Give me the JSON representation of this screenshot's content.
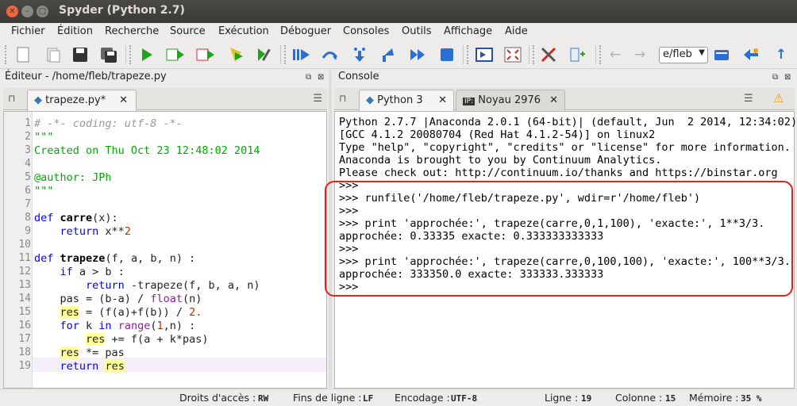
{
  "window": {
    "title": "Spyder (Python 2.7)"
  },
  "menu": [
    "Fichier",
    "Édition",
    "Recherche",
    "Source",
    "Exécution",
    "Déboguer",
    "Consoles",
    "Outils",
    "Affichage",
    "Aide"
  ],
  "toolbar": {
    "working_dir": "e/fleb"
  },
  "editor_pane": {
    "title": "Éditeur - /home/fleb/trapeze.py",
    "tab_label": "trapeze.py*",
    "current_line": 19
  },
  "console_pane": {
    "title": "Console",
    "tabs": [
      {
        "label": "Python 3"
      },
      {
        "label": "Noyau 2976"
      }
    ],
    "lines": [
      "Python 2.7.7 |Anaconda 2.0.1 (64-bit)| (default, Jun  2 2014, 12:34:02)",
      "[GCC 4.1.2 20080704 (Red Hat 4.1.2-54)] on linux2",
      "Type \"help\", \"copyright\", \"credits\" or \"license\" for more information.",
      "Anaconda is brought to you by Continuum Analytics.",
      "Please check out: http://continuum.io/thanks and https://binstar.org",
      ">>> ",
      ">>> runfile('/home/fleb/trapeze.py', wdir=r'/home/fleb')",
      ">>> ",
      ">>> print 'approchée:', trapeze(carre,0,1,100), 'exacte:', 1**3/3.",
      "approchée: 0.33335 exacte: 0.333333333333",
      ">>> ",
      ">>> print 'approchée:', trapeze(carre,0,100,100), 'exacte:', 100**3/3.",
      "approchée: 333350.0 exacte: 333333.333333",
      ">>> "
    ]
  },
  "status": {
    "access_label": "Droits d'accès :",
    "access": "RW",
    "eol_label": "Fins de ligne :",
    "eol": "LF",
    "encoding_label": "Encodage :",
    "encoding": "UTF-8",
    "line_label": "Ligne :",
    "line": "19",
    "column_label": "Colonne :",
    "column": "15",
    "memory_label": "Mémoire :",
    "memory": "35 %"
  }
}
